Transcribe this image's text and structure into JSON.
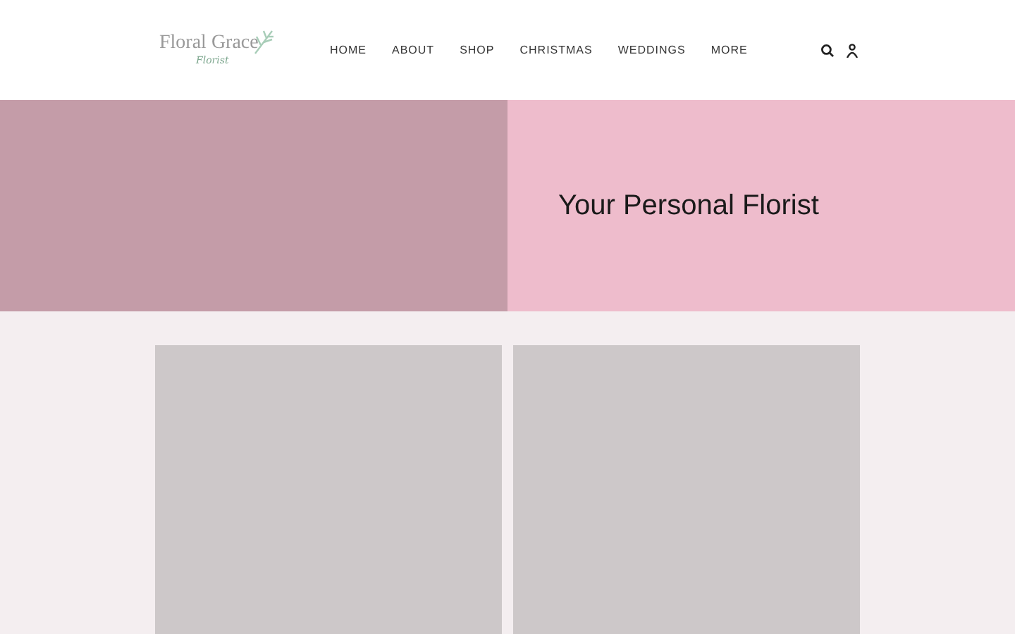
{
  "logo": {
    "name": "Floral Grace",
    "tagline": "Florist"
  },
  "nav": [
    "HOME",
    "ABOUT",
    "SHOP",
    "CHRISTMAS",
    "WEDDINGS",
    "MORE"
  ],
  "hero": {
    "title": "Your Personal Florist"
  }
}
